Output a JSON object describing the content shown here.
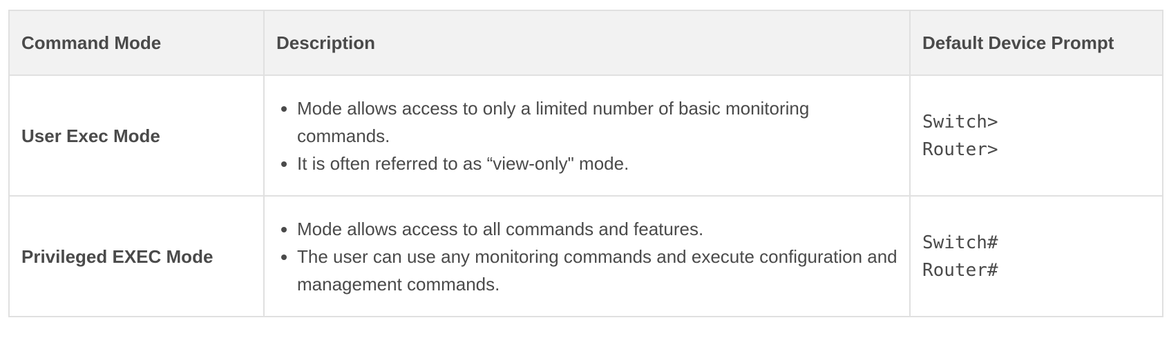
{
  "table": {
    "headers": {
      "command_mode": "Command Mode",
      "description": "Description",
      "prompt": "Default Device Prompt"
    },
    "rows": [
      {
        "mode": "User Exec Mode",
        "bullets": [
          "Mode allows access to only a limited number of basic monitoring commands.",
          "It is often referred to as “view-only\" mode."
        ],
        "prompts": [
          "Switch>",
          "Router>"
        ]
      },
      {
        "mode": "Privileged EXEC Mode",
        "bullets": [
          "Mode allows access to all commands and features.",
          "The user can use any monitoring commands and execute configuration and management commands."
        ],
        "prompts": [
          "Switch#",
          "Router#"
        ]
      }
    ]
  }
}
